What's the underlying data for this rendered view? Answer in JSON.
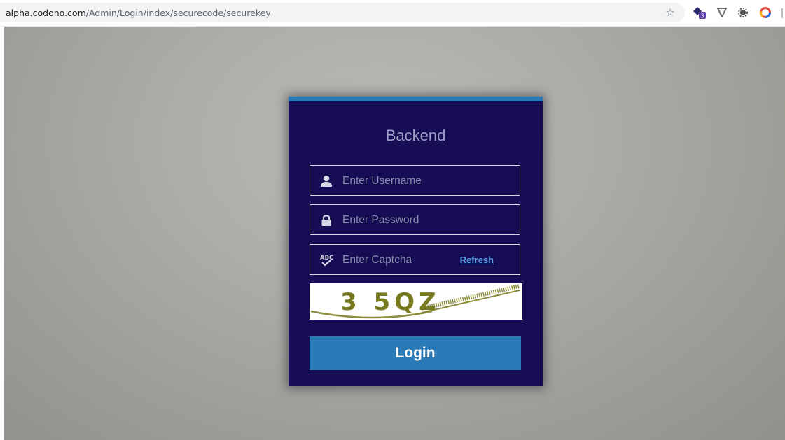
{
  "browser": {
    "url_host": "alpha.codono.com",
    "url_path": "/Admin/Login/index/securecode/securekey",
    "extension_badge": "3",
    "icons": [
      "star-icon",
      "extension-gem-icon",
      "extension-v-icon",
      "extension-gear-icon",
      "extension-ring-icon"
    ]
  },
  "login": {
    "title": "Backend",
    "username_placeholder": "Enter Username",
    "password_placeholder": "Enter Password",
    "captcha_placeholder": "Enter Captcha",
    "refresh_label": "Refresh",
    "captcha_text": "3 5QZ",
    "login_label": "Login"
  },
  "colors": {
    "card_background": "#160d55",
    "accent": "#2a7ab8",
    "refresh_link": "#5ea0e6",
    "captcha_text": "#777a1e"
  }
}
